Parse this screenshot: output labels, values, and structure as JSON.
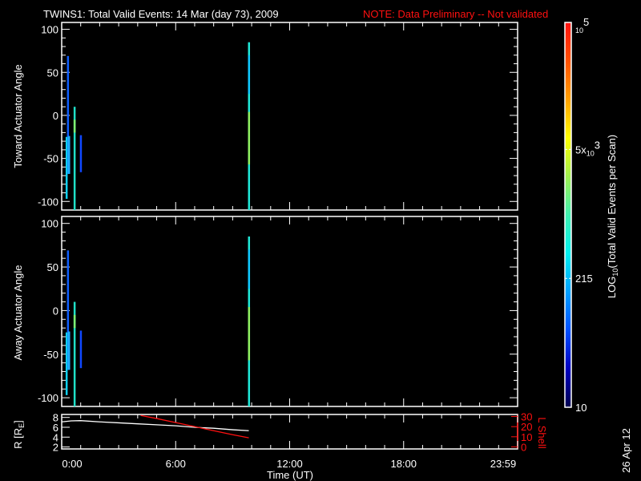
{
  "title": {
    "main": "TWINS1: Total Valid Events: 14 Mar (day  73), 2009",
    "note": "NOTE: Data Preliminary -- Not validated"
  },
  "date_stamp": "26 Apr 12",
  "colors": {
    "background": "#000000",
    "axis": "#ffffff",
    "note": "#ff1010",
    "lshell": "#ff1010",
    "r_line": "#ffffff"
  },
  "chart_data": [
    {
      "type": "heatmap",
      "name": "toward",
      "ylabel": "Toward Actuator Angle",
      "xlim": [
        0,
        24
      ],
      "ylim": [
        -110,
        108
      ],
      "yticks": [
        100,
        50,
        0,
        -50,
        -100
      ],
      "segments": [
        {
          "time": 0.32,
          "angle_from": 69,
          "angle_to": -68,
          "color": "#1060ff"
        },
        {
          "time": 0.25,
          "angle_from": -25,
          "angle_to": -97,
          "color": "#10d0f0"
        },
        {
          "time": 0.38,
          "angle_from": -24,
          "angle_to": -68,
          "color": "#20b0ff"
        },
        {
          "time": 0.67,
          "angle_from": 10,
          "angle_to": -110,
          "color": "#20e0c8"
        },
        {
          "time": 0.67,
          "angle_from": -5,
          "angle_to": -20,
          "color": "#80f070"
        },
        {
          "time": 1.0,
          "angle_from": -23,
          "angle_to": -66,
          "color": "#1048ff"
        },
        {
          "time": 9.85,
          "angle_from": 85,
          "angle_to": -110,
          "color": "#20e8d8"
        },
        {
          "time": 9.85,
          "angle_from": 70,
          "angle_to": 25,
          "color": "#10c8ff"
        },
        {
          "time": 9.85,
          "angle_from": 4,
          "angle_to": -57,
          "color": "#90f060"
        }
      ]
    },
    {
      "type": "heatmap",
      "name": "away",
      "ylabel": "Away Actuator Angle",
      "xlim": [
        0,
        24
      ],
      "ylim": [
        -110,
        108
      ],
      "yticks": [
        100,
        50,
        0,
        -50,
        -100
      ],
      "segments": [
        {
          "time": 0.32,
          "angle_from": 69,
          "angle_to": -68,
          "color": "#1060ff"
        },
        {
          "time": 0.25,
          "angle_from": -25,
          "angle_to": -97,
          "color": "#10d0f0"
        },
        {
          "time": 0.38,
          "angle_from": -24,
          "angle_to": -68,
          "color": "#20b0ff"
        },
        {
          "time": 0.67,
          "angle_from": 10,
          "angle_to": -110,
          "color": "#20e0c8"
        },
        {
          "time": 0.67,
          "angle_from": -5,
          "angle_to": -20,
          "color": "#80f070"
        },
        {
          "time": 1.0,
          "angle_from": -23,
          "angle_to": -66,
          "color": "#1048ff"
        },
        {
          "time": 9.85,
          "angle_from": 85,
          "angle_to": -110,
          "color": "#20e8d8"
        },
        {
          "time": 9.85,
          "angle_from": 70,
          "angle_to": 25,
          "color": "#10c8ff"
        },
        {
          "time": 9.85,
          "angle_from": 4,
          "angle_to": -57,
          "color": "#90f060"
        }
      ]
    },
    {
      "type": "line",
      "name": "orbit",
      "ylabel": "R [R",
      "ylabel_sub": "E",
      "ylabel_end": "]",
      "y2label": "L Shell",
      "xlabel": "Time (UT)",
      "xlim": [
        0,
        24
      ],
      "ylim": [
        1.6,
        8.6
      ],
      "y2lim": [
        -2,
        32
      ],
      "yticks": [
        8,
        6,
        4,
        2
      ],
      "y2ticks": [
        30,
        20,
        10,
        0
      ],
      "xticks": [
        {
          "v": 0,
          "label": "0:00"
        },
        {
          "v": 6,
          "label": "6:00"
        },
        {
          "v": 12,
          "label": "12:00"
        },
        {
          "v": 18,
          "label": "18:00"
        },
        {
          "v": 24,
          "label": "23:59"
        }
      ],
      "series": [
        {
          "name": "R",
          "axis": "left",
          "x": [
            0,
            0.5,
            1.0,
            2,
            3,
            4,
            5,
            6,
            7,
            8,
            9,
            9.85
          ],
          "y": [
            7.1,
            7.3,
            7.35,
            7.1,
            6.9,
            6.7,
            6.5,
            6.3,
            6.0,
            5.8,
            5.5,
            5.3
          ]
        },
        {
          "name": "L Shell",
          "axis": "right",
          "x": [
            4.16,
            5,
            6,
            7,
            8,
            9,
            9.85
          ],
          "y": [
            31,
            28,
            24,
            20,
            16,
            12,
            9
          ]
        }
      ]
    }
  ],
  "colorbar": {
    "label": "LOG",
    "label_sub": "10",
    "label_rest": "(Total Valid  Events per Scan)",
    "ticks": [
      {
        "base": "10",
        "sup": "5",
        "pos": 1.0,
        "prefix": ""
      },
      {
        "base": "10",
        "sup": "3",
        "pos": 0.67,
        "prefix": "5x"
      },
      {
        "base": "215",
        "sup": "",
        "pos": 0.335,
        "prefix": ""
      },
      {
        "base": "10",
        "sup": "",
        "pos": 0.0,
        "prefix": ""
      }
    ],
    "range": [
      10,
      100000
    ],
    "stops": [
      "#000050",
      "#0000c0",
      "#0050ff",
      "#00a0ff",
      "#00f0f0",
      "#40f0b0",
      "#a0f050",
      "#ffff00",
      "#ffa000",
      "#ff5000",
      "#ff1010"
    ]
  }
}
